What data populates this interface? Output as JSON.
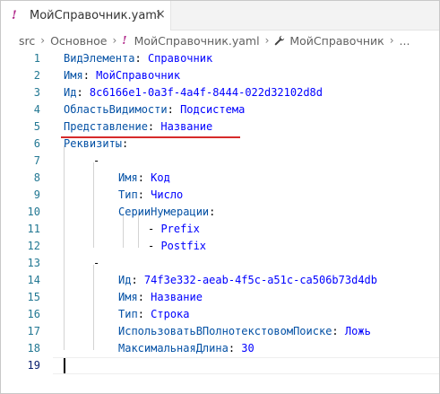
{
  "tab": {
    "label": "МойСправочник.yaml",
    "close_glyph": "×"
  },
  "breadcrumb": {
    "items": [
      "src",
      "Основное",
      "МойСправочник.yaml",
      "МойСправочник"
    ],
    "more": "..."
  },
  "editor": {
    "lines": [
      {
        "n": "1",
        "key": "ВидЭлемента",
        "val": "Справочник"
      },
      {
        "n": "2",
        "key": "Имя",
        "val": "МойСправочник"
      },
      {
        "n": "3",
        "key": "Ид",
        "val": "8c6166e1-0a3f-4a4f-8444-022d32102d8d"
      },
      {
        "n": "4",
        "key": "ОбластьВидимости",
        "val": "Подсистема"
      },
      {
        "n": "5",
        "key": "Представление",
        "val": "Название"
      },
      {
        "n": "6",
        "key": "Реквизиты",
        "val": ""
      },
      {
        "n": "7",
        "dash": "-"
      },
      {
        "n": "8",
        "key": "Имя",
        "val": "Код"
      },
      {
        "n": "9",
        "key": "Тип",
        "val": "Число"
      },
      {
        "n": "10",
        "key": "СерииНумерации",
        "val": ""
      },
      {
        "n": "11",
        "item": "Prefix"
      },
      {
        "n": "12",
        "item": "Postfix"
      },
      {
        "n": "13",
        "dash": "-"
      },
      {
        "n": "14",
        "key": "Ид",
        "val": "74f3e332-aeab-4f5c-a51c-ca506b73d4db"
      },
      {
        "n": "15",
        "key": "Имя",
        "val": "Название"
      },
      {
        "n": "16",
        "key": "Тип",
        "val": "Строка"
      },
      {
        "n": "17",
        "key": "ИспользоватьВПолнотекстовомПоиске",
        "val": "Ложь"
      },
      {
        "n": "18",
        "key": "МаксимальнаяДлина",
        "val": "30"
      },
      {
        "n": "19"
      }
    ]
  },
  "colors": {
    "key": "#0451a5",
    "value": "#0000ff",
    "line_number": "#237893",
    "annotation_underline": "#d62b2b"
  }
}
